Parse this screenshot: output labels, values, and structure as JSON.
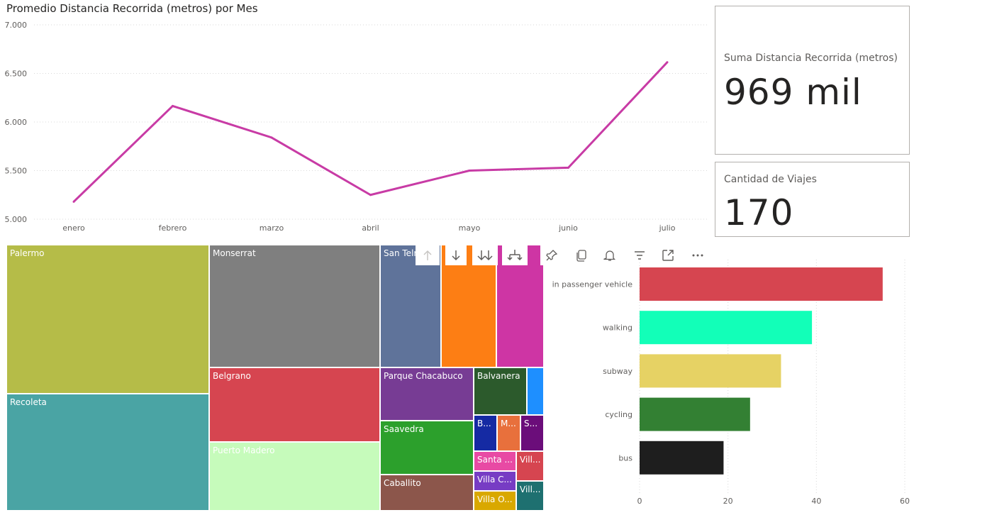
{
  "line_visual": {
    "title": "Promedio Distancia Recorrida (metros) por Mes"
  },
  "card_distance": {
    "label": "Suma Distancia Recorrida (metros)",
    "value": "969 mil"
  },
  "card_trips": {
    "label": "Cantidad de Viajes",
    "value": "170"
  },
  "treemap": {
    "tiles": [
      {
        "label": "Palermo",
        "color": "#b5bc48"
      },
      {
        "label": "Recoleta",
        "color": "#4aa4a4"
      },
      {
        "label": "Monserrat",
        "color": "#7f7f7f"
      },
      {
        "label": "Belgrano",
        "color": "#d64550"
      },
      {
        "label": "Puerto Madero",
        "color": "#c6fbbb"
      },
      {
        "label": "San Telmo",
        "color": "#5f739a"
      },
      {
        "label": "",
        "color": "#fd7e14"
      },
      {
        "label": "",
        "color": "#ce35a4"
      },
      {
        "label": "Parque Chacabuco",
        "color": "#773c94"
      },
      {
        "label": "Saavedra",
        "color": "#2ca02c"
      },
      {
        "label": "Caballito",
        "color": "#8c564b"
      },
      {
        "label": "Balvanera",
        "color": "#2c5a2c"
      },
      {
        "label": "",
        "color": "#1e8fff"
      },
      {
        "label": "B...",
        "color": "#152aa3"
      },
      {
        "label": "M...",
        "color": "#e8703c"
      },
      {
        "label": "S...",
        "color": "#6b0d7a"
      },
      {
        "label": "Santa ...",
        "color": "#e84aa4"
      },
      {
        "label": "Vill...",
        "color": "#d64550"
      },
      {
        "label": "Villa C...",
        "color": "#773cc4"
      },
      {
        "label": "Vill...",
        "color": "#1e7070"
      },
      {
        "label": "Villa O...",
        "color": "#d9a800"
      }
    ]
  },
  "visual_header": {
    "icons": [
      "arrow-up-icon",
      "arrow-down-icon",
      "double-arrow-down-icon",
      "expand-hierarchy-icon",
      "pin-icon",
      "copy-icon",
      "bell-icon",
      "filter-icon",
      "focus-mode-icon",
      "more-options-icon"
    ]
  },
  "chart_data": [
    {
      "type": "line",
      "title": "Promedio Distancia Recorrida (metros) por Mes",
      "xlabel": "",
      "ylabel": "",
      "categories": [
        "enero",
        "febrero",
        "marzo",
        "abril",
        "mayo",
        "junio",
        "julio"
      ],
      "series": [
        {
          "values": [
            5180,
            6165,
            5840,
            5250,
            5500,
            5530,
            6615
          ],
          "color": "#c83ba5"
        }
      ],
      "ylim": [
        5000,
        7000
      ],
      "y_ticks": [
        "5.000",
        "5.500",
        "6.000",
        "6.500",
        "7.000"
      ],
      "grid": true
    },
    {
      "type": "bar",
      "orientation": "horizontal",
      "title": "",
      "categories": [
        "in passenger vehicle",
        "walking",
        "subway",
        "cycling",
        "bus"
      ],
      "values": [
        55,
        39,
        32,
        25,
        19
      ],
      "colors": [
        "#d64550",
        "#12ffb8",
        "#e6d264",
        "#338033",
        "#1e1e1e"
      ],
      "xlim": [
        0,
        60
      ],
      "x_ticks": [
        "0",
        "20",
        "40",
        "60"
      ],
      "grid": true
    }
  ]
}
